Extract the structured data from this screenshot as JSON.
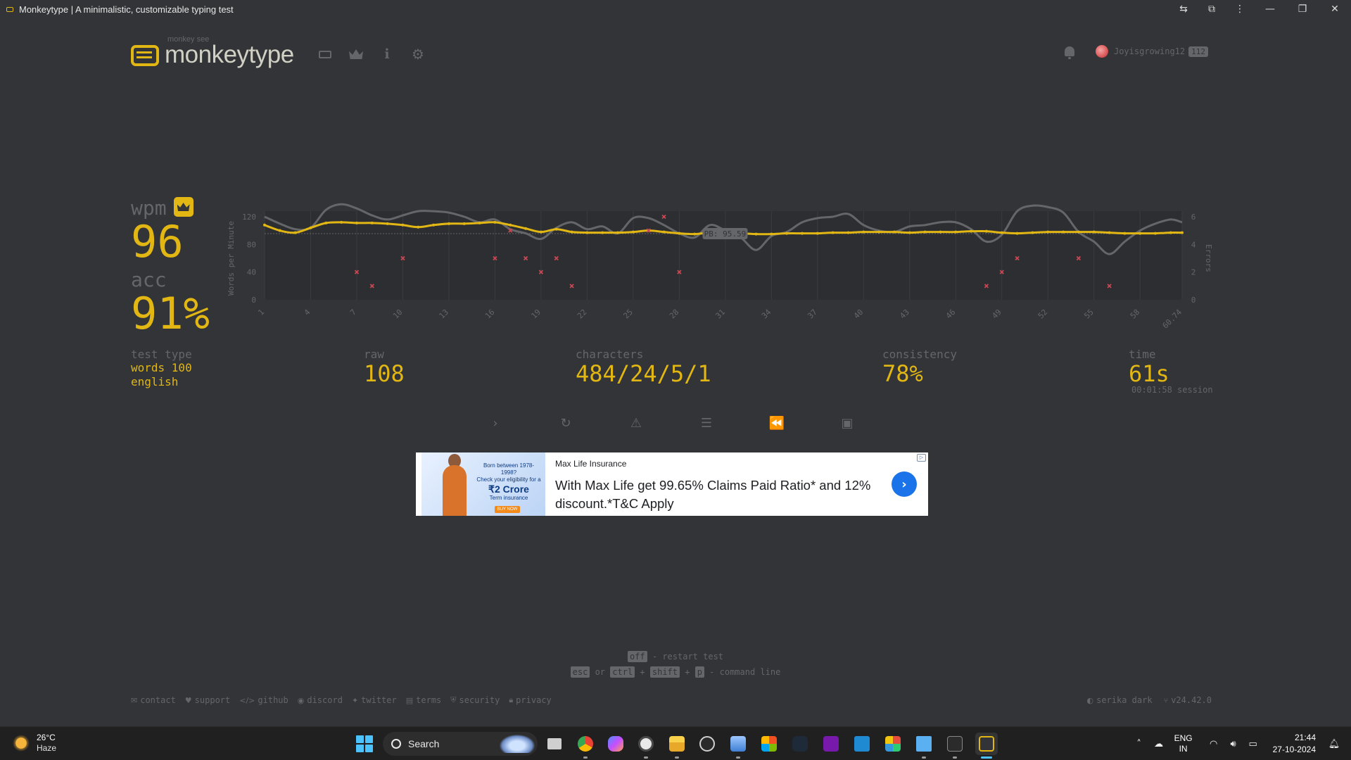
{
  "window": {
    "title": "Monkeytype | A minimalistic, customizable typing test",
    "controls": [
      "translate-icon",
      "extensions-icon",
      "menu-icon",
      "minimize",
      "maximize",
      "close"
    ]
  },
  "header": {
    "logo_sub": "monkey see",
    "logo_text": "monkeytype",
    "nav": [
      "keyboard-icon",
      "crown-icon",
      "info-icon",
      "gear-icon"
    ],
    "username": "Joyisgrowing12",
    "level": "112"
  },
  "result": {
    "wpm_label": "wpm",
    "wpm": "96",
    "acc_label": "acc",
    "acc": "91%",
    "test_type_label": "test type",
    "test_type_1": "words 100",
    "test_type_2": "english",
    "raw_label": "raw",
    "raw": "108",
    "characters_label": "characters",
    "characters": "484/24/5/1",
    "consistency_label": "consistency",
    "consistency": "78%",
    "time_label": "time",
    "time": "61s",
    "session": "00:01:58 session"
  },
  "chart_data": {
    "type": "line",
    "ylabel": "Words per Minute",
    "y2label": "Errors",
    "ylim": [
      0,
      120
    ],
    "y_ticks": [
      0,
      40,
      80,
      120
    ],
    "y2lim": [
      0,
      6
    ],
    "y2_ticks": [
      0,
      2,
      4,
      6
    ],
    "x_tick_labels": [
      "1",
      "4",
      "7",
      "10",
      "13",
      "16",
      "19",
      "22",
      "25",
      "28",
      "31",
      "34",
      "37",
      "40",
      "43",
      "46",
      "49",
      "52",
      "55",
      "58",
      "60.74"
    ],
    "pb_label": "PB: 95.59",
    "pb_value": 95.59,
    "grid": true,
    "legend": "none",
    "series": [
      {
        "name": "wpm",
        "color": "#e2b714",
        "points": [
          [
            1,
            108
          ],
          [
            2,
            100
          ],
          [
            3,
            97
          ],
          [
            4,
            104
          ],
          [
            5,
            111
          ],
          [
            6,
            112
          ],
          [
            7,
            111
          ],
          [
            8,
            111
          ],
          [
            9,
            110
          ],
          [
            10,
            108
          ],
          [
            11,
            105
          ],
          [
            12,
            108
          ],
          [
            13,
            110
          ],
          [
            14,
            110
          ],
          [
            15,
            111
          ],
          [
            16,
            112
          ],
          [
            17,
            108
          ],
          [
            18,
            103
          ],
          [
            19,
            98
          ],
          [
            20,
            102
          ],
          [
            21,
            98
          ],
          [
            22,
            97
          ],
          [
            23,
            97
          ],
          [
            24,
            97
          ],
          [
            25,
            98
          ],
          [
            26,
            100
          ],
          [
            27,
            98
          ],
          [
            28,
            96
          ],
          [
            29,
            95
          ],
          [
            30,
            97
          ],
          [
            31,
            96
          ],
          [
            32,
            96
          ],
          [
            33,
            95
          ],
          [
            34,
            95
          ],
          [
            35,
            96
          ],
          [
            36,
            96
          ],
          [
            37,
            96
          ],
          [
            38,
            97
          ],
          [
            39,
            97
          ],
          [
            40,
            98
          ],
          [
            41,
            98
          ],
          [
            42,
            98
          ],
          [
            43,
            97
          ],
          [
            44,
            98
          ],
          [
            45,
            98
          ],
          [
            46,
            98
          ],
          [
            47,
            99
          ],
          [
            48,
            99
          ],
          [
            49,
            97
          ],
          [
            50,
            96
          ],
          [
            51,
            97
          ],
          [
            52,
            98
          ],
          [
            53,
            98
          ],
          [
            54,
            98
          ],
          [
            55,
            98
          ],
          [
            56,
            97
          ],
          [
            57,
            96
          ],
          [
            58,
            96
          ],
          [
            59,
            96
          ],
          [
            60,
            97
          ],
          [
            60.74,
            97
          ]
        ]
      },
      {
        "name": "raw",
        "color": "#646669",
        "points": [
          [
            1,
            120
          ],
          [
            2,
            110
          ],
          [
            3,
            102
          ],
          [
            4,
            104
          ],
          [
            5,
            130
          ],
          [
            6,
            138
          ],
          [
            7,
            132
          ],
          [
            8,
            122
          ],
          [
            9,
            116
          ],
          [
            10,
            122
          ],
          [
            11,
            128
          ],
          [
            12,
            128
          ],
          [
            13,
            126
          ],
          [
            14,
            120
          ],
          [
            15,
            112
          ],
          [
            16,
            116
          ],
          [
            17,
            102
          ],
          [
            18,
            96
          ],
          [
            19,
            88
          ],
          [
            20,
            104
          ],
          [
            21,
            112
          ],
          [
            22,
            102
          ],
          [
            23,
            106
          ],
          [
            24,
            96
          ],
          [
            25,
            118
          ],
          [
            26,
            118
          ],
          [
            27,
            108
          ],
          [
            28,
            96
          ],
          [
            29,
            90
          ],
          [
            30,
            108
          ],
          [
            31,
            100
          ],
          [
            32,
            90
          ],
          [
            33,
            72
          ],
          [
            34,
            92
          ],
          [
            35,
            98
          ],
          [
            36,
            112
          ],
          [
            37,
            118
          ],
          [
            38,
            120
          ],
          [
            39,
            124
          ],
          [
            40,
            108
          ],
          [
            41,
            100
          ],
          [
            42,
            98
          ],
          [
            43,
            106
          ],
          [
            44,
            108
          ],
          [
            45,
            112
          ],
          [
            46,
            112
          ],
          [
            47,
            102
          ],
          [
            48,
            84
          ],
          [
            49,
            94
          ],
          [
            50,
            128
          ],
          [
            51,
            136
          ],
          [
            52,
            134
          ],
          [
            53,
            126
          ],
          [
            54,
            98
          ],
          [
            55,
            84
          ],
          [
            56,
            66
          ],
          [
            57,
            84
          ],
          [
            58,
            100
          ],
          [
            59,
            110
          ],
          [
            60,
            116
          ],
          [
            60.74,
            112
          ]
        ]
      },
      {
        "name": "errors",
        "color": "#ca4754",
        "type": "scatter",
        "points": [
          [
            7,
            2
          ],
          [
            8,
            1
          ],
          [
            10,
            3
          ],
          [
            16,
            3
          ],
          [
            17,
            5
          ],
          [
            18,
            3
          ],
          [
            19,
            2
          ],
          [
            20,
            3
          ],
          [
            21,
            1
          ],
          [
            26,
            5
          ],
          [
            27,
            6
          ],
          [
            28,
            2
          ],
          [
            48,
            1
          ],
          [
            49,
            2
          ],
          [
            50,
            3
          ],
          [
            54,
            3
          ],
          [
            56,
            1
          ]
        ]
      }
    ]
  },
  "actions": [
    "next-test",
    "restart",
    "report",
    "words-history",
    "replay",
    "screenshot"
  ],
  "ad": {
    "brand": "Max Life Insurance",
    "headline": "With Max Life get 99.65% Claims Paid Ratio* and 12% discount.*T&C Apply",
    "image_top": "Born between 1978-1998?",
    "image_mid": "Check your eligibility for a",
    "image_big": "₹2 Crore",
    "image_sub": "Term insurance",
    "image_btn": "BUY NOW"
  },
  "hints": {
    "key1": "off",
    "text1": "- restart test",
    "key2": "esc",
    "or": "or",
    "key3": "ctrl",
    "plus1": "+",
    "key4": "shift",
    "plus2": "+",
    "key5": "p",
    "text2": "- command line"
  },
  "footer": {
    "links": [
      "contact",
      "support",
      "github",
      "discord",
      "twitter",
      "terms",
      "security",
      "privacy"
    ],
    "theme": "serika dark",
    "version": "v24.42.0"
  },
  "taskbar": {
    "temp": "26°C",
    "weather": "Haze",
    "search": "Search",
    "lang_1": "ENG",
    "lang_2": "IN",
    "time": "21:44",
    "date": "27-10-2024"
  },
  "colors": {
    "bg": "#323437",
    "main": "#e2b714",
    "sub": "#646669",
    "text": "#d1d0c5",
    "error": "#ca4754"
  }
}
